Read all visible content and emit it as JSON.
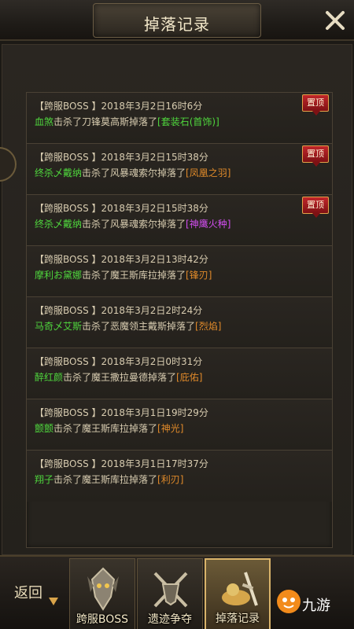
{
  "header": {
    "title": "掉落记录"
  },
  "records": [
    {
      "tag": "【跨服BOSS 】",
      "time": "2018年3月2日16时6分",
      "player": "血煞",
      "action": "击杀了刀锋莫高斯掉落了",
      "item": "[套装石(首饰)]",
      "item_color": "green",
      "pinned": true
    },
    {
      "tag": "【跨服BOSS 】",
      "time": "2018年3月2日15时38分",
      "player": "终杀乄戴纳",
      "action": "击杀了风暴魂索尔掉落了",
      "item": "[凤凰之羽]",
      "item_color": "orange",
      "pinned": true
    },
    {
      "tag": "【跨服BOSS 】",
      "time": "2018年3月2日15时38分",
      "player": "终杀乄戴纳",
      "action": "击杀了风暴魂索尔掉落了",
      "item": "[神鹰火种]",
      "item_color": "purple",
      "pinned": true
    },
    {
      "tag": "【跨服BOSS 】",
      "time": "2018年3月2日13时42分",
      "player": "摩利お黛娜",
      "action": "击杀了魔王斯库拉掉落了",
      "item": "[锋刃]",
      "item_color": "orange",
      "pinned": false
    },
    {
      "tag": "【跨服BOSS 】",
      "time": "2018年3月2日2时24分",
      "player": "马奇乄艾斯",
      "action": "击杀了恶魔领主戴斯掉落了",
      "item": "[烈焰]",
      "item_color": "orange",
      "pinned": false
    },
    {
      "tag": "【跨服BOSS 】",
      "time": "2018年3月2日0时31分",
      "player": "醉红颜",
      "action": "击杀了魔王撒拉曼德掉落了",
      "item": "[庇佑]",
      "item_color": "orange",
      "pinned": false
    },
    {
      "tag": "【跨服BOSS 】",
      "time": "2018年3月1日19时29分",
      "player": "颤颤",
      "action": "击杀了魔王斯库拉掉落了",
      "item": "[神光]",
      "item_color": "orange",
      "pinned": false
    },
    {
      "tag": "【跨服BOSS 】",
      "time": "2018年3月1日17时37分",
      "player": "翔子",
      "action": "击杀了魔王斯库拉掉落了",
      "item": "[利刃]",
      "item_color": "orange",
      "pinned": false
    }
  ],
  "pin_label": "置顶",
  "bottom": {
    "back_label": "返回",
    "tabs": [
      {
        "label": "跨服BOSS",
        "icon": "boss-icon",
        "active": false
      },
      {
        "label": "遗迹争夺",
        "icon": "crossed-swords-icon",
        "active": false
      },
      {
        "label": "掉落记录",
        "icon": "treasure-icon",
        "active": true
      }
    ],
    "logo_text": "九游"
  },
  "colors": {
    "player": "#4fd63d",
    "item_green": "#4fd63d",
    "item_orange": "#e08a2a",
    "item_purple": "#d24ef0",
    "pin_red": "#c0262a"
  }
}
